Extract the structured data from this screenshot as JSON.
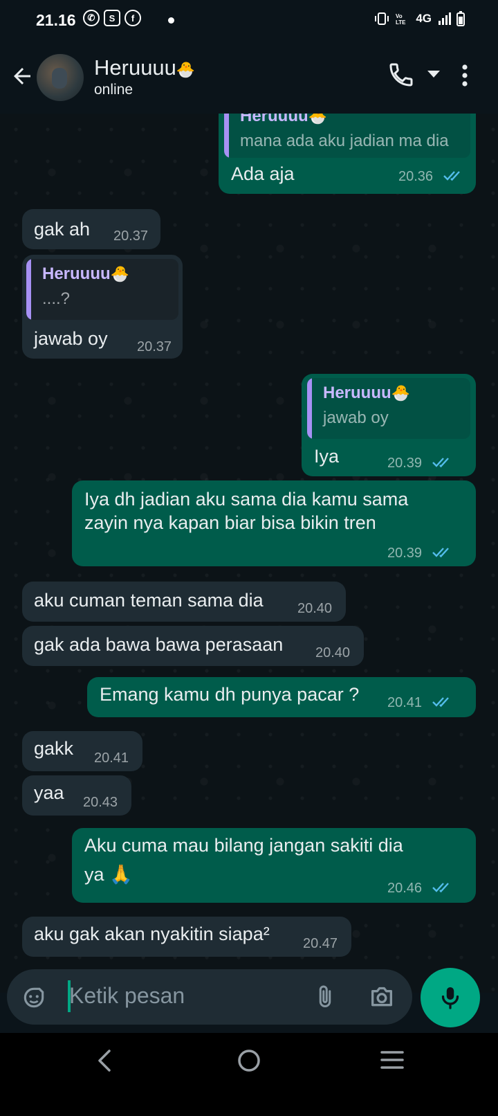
{
  "status_bar": {
    "time": "21.16",
    "network": "4G"
  },
  "header": {
    "contact_name": "Heruuuu",
    "status": "online"
  },
  "messages": [
    {
      "dir": "out",
      "quote_name": "Heruuuu",
      "quote_text": "mana ada aku jadian ma dia",
      "text": "Ada aja",
      "time": "20.36"
    },
    {
      "dir": "in",
      "text": "gak ah",
      "time": "20.37"
    },
    {
      "dir": "in",
      "quote_name": "Heruuuu",
      "quote_text": "....?",
      "text": "jawab oy",
      "time": "20.37"
    },
    {
      "dir": "out",
      "quote_name": "Heruuuu",
      "quote_text": "jawab oy",
      "text": "Iya",
      "time": "20.39"
    },
    {
      "dir": "out",
      "text_line1": "Iya dh jadian aku sama dia kamu sama",
      "text_line2": "zayin nya kapan biar bisa bikin tren",
      "time": "20.39"
    },
    {
      "dir": "in",
      "text": "aku cuman teman sama dia",
      "time": "20.40"
    },
    {
      "dir": "in",
      "text": "gak ada bawa bawa perasaan",
      "time": "20.40"
    },
    {
      "dir": "out",
      "text": "Emang kamu  dh punya pacar ?",
      "time": "20.41"
    },
    {
      "dir": "in",
      "text": "gakk",
      "time": "20.41"
    },
    {
      "dir": "in",
      "text": "yaa",
      "time": "20.43"
    },
    {
      "dir": "out",
      "text_line1": "Aku cuma mau bilang jangan sakiti dia",
      "text_line2": "ya 🙏",
      "time": "20.46"
    },
    {
      "dir": "in",
      "text": "aku gak akan nyakitin siapa²",
      "time": "20.47"
    }
  ],
  "composer": {
    "placeholder": "Ketik pesan"
  },
  "colors": {
    "incoming": "#1f2c34",
    "outgoing": "#005c4b",
    "accent": "#00a884",
    "read_ticks": "#53bdeb",
    "quote_bar": "#a791f4"
  },
  "icons": [
    "back-arrow-icon",
    "call-icon",
    "dropdown-icon",
    "more-vert-icon",
    "sticker-icon",
    "attach-icon",
    "camera-icon",
    "mic-icon",
    "nav-back-icon",
    "nav-home-icon",
    "nav-recents-icon"
  ]
}
